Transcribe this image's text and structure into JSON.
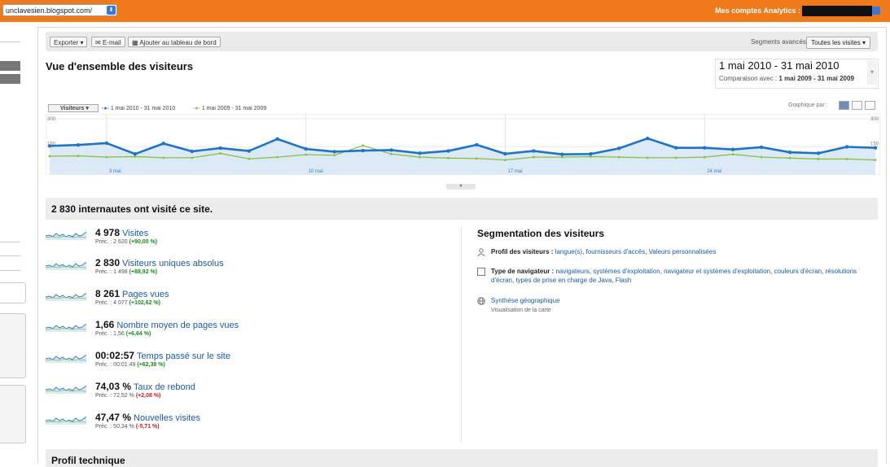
{
  "browser": {
    "url_value": "unclavesien.blogspot.com/",
    "accounts_label": "Mes comptes Analytics :"
  },
  "toolbar": {
    "export_label": "Exporter",
    "email_label": "E-mail",
    "dashboard_label": "Ajouter au tableau de bord",
    "segments_label": "Segments avancés",
    "segments_value": "Toutes les visites"
  },
  "header": {
    "title": "Vue d'ensemble des visiteurs",
    "date_range": "1 mai 2010 - 31 mai 2010",
    "comparison_prefix": "Comparaison avec :",
    "comparison_range": "1 mai 2009 - 31 mai 2009"
  },
  "graph": {
    "metric_select": "Visiteurs",
    "legend_current": "1 mai 2010 - 31 mai 2010",
    "legend_previous": "1 mai 2009 - 31 mai 2009",
    "graph_by_label": "Graphique par :"
  },
  "chart_data": {
    "type": "line",
    "x_ticks": [
      "3 mai",
      "10 mai",
      "17 mai",
      "24 mai"
    ],
    "y_ticks_left": [
      "300",
      "150"
    ],
    "y_ticks_right": [
      "300",
      "150"
    ],
    "ylim": [
      0,
      300
    ],
    "colors": {
      "current": "#1f74c8",
      "previous": "#8cbf3f",
      "fill": "#dbeaf6"
    },
    "series": [
      {
        "name": "1 mai 2010 - 31 mai 2010",
        "values": [
          155,
          160,
          170,
          112,
          168,
          126,
          143,
          128,
          192,
          139,
          124,
          130,
          133,
          116,
          128,
          161,
          113,
          128,
          110,
          112,
          142,
          195,
          145,
          145,
          136,
          148,
          121,
          116,
          150,
          145
        ]
      },
      {
        "name": "1 mai 2009 - 31 mai 2009",
        "values": [
          100,
          102,
          95,
          98,
          92,
          92,
          115,
          86,
          95,
          108,
          105,
          157,
          112,
          95,
          90,
          88,
          80,
          95,
          95,
          98,
          95,
          92,
          92,
          95,
          110,
          95,
          90,
          85,
          85,
          80
        ]
      }
    ]
  },
  "summary": {
    "visitors_line": "2 830 internautes ont visité ce site."
  },
  "metrics": [
    {
      "value": "4 978",
      "label": "Visites",
      "prev": "Préc. : 2 620",
      "change": "(+90,00 %)",
      "trend": "pos"
    },
    {
      "value": "2 830",
      "label": "Visiteurs uniques absolus",
      "prev": "Préc. : 1 498",
      "change": "(+88,92 %)",
      "trend": "pos"
    },
    {
      "value": "8 261",
      "label": "Pages vues",
      "prev": "Préc. : 4 077",
      "change": "(+102,62 %)",
      "trend": "pos"
    },
    {
      "value": "1,66",
      "label": "Nombre moyen de pages vues",
      "prev": "Préc. : 1,56",
      "change": "(+6,64 %)",
      "trend": "pos"
    },
    {
      "value": "00:02:57",
      "label": "Temps passé sur le site",
      "prev": "Préc. : 00:01:49",
      "change": "(+62,38 %)",
      "trend": "pos"
    },
    {
      "value": "74,03 %",
      "label": "Taux de rebond",
      "prev": "Préc. : 72,52 %",
      "change": "(+2,08 %)",
      "trend": "neg"
    },
    {
      "value": "47,47 %",
      "label": "Nouvelles visites",
      "prev": "Préc. : 50,34 %",
      "change": "(-5,71 %)",
      "trend": "neg"
    }
  ],
  "segmentation": {
    "title": "Segmentation des visiteurs",
    "profile_label": "Profil des visiteurs :",
    "profile_links": [
      "langue(s)",
      "fournisseurs d'accès",
      "Valeurs personnalisées"
    ],
    "browser_label": "Type de navigateur :",
    "browser_links": [
      "navigateurs",
      "systèmes d'exploitation",
      "navigateur et systèmes d'exploitation",
      "couleurs d'écran",
      "résolutions d'écran",
      "types de prise en charge de Java",
      "Flash"
    ],
    "geo_link": "Synthèse géographique",
    "geo_sub": "Visualisation de la carte"
  },
  "technical_profile": {
    "title": "Profil technique"
  }
}
